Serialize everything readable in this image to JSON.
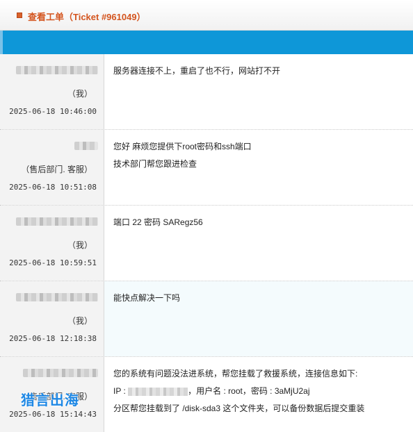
{
  "header": {
    "title": "查看工单（Ticket #961049）"
  },
  "messages": [
    {
      "role": "（我）",
      "time": "2025-06-18 10:46:00",
      "lines": [
        "服务器连接不上，重启了也不行，网站打不开"
      ]
    },
    {
      "role": "（售后部门. 客服）",
      "time": "2025-06-18 10:51:08",
      "lines": [
        "您好 麻烦您提供下root密码和ssh端口",
        "技术部门帮您跟进检查"
      ]
    },
    {
      "role": "（我）",
      "time": "2025-06-18 10:59:51",
      "lines": [
        "端口 22 密码 SARegz56"
      ]
    },
    {
      "role": "（我）",
      "time": "2025-06-18 12:18:38",
      "lines": [
        "能快点解决一下吗"
      ]
    },
    {
      "role": "（售后部门. 客服）",
      "time": "2025-06-18 15:14:43",
      "lines": [
        "您的系统有问题没法进系统，帮您挂载了救援系统，连接信息如下:"
      ],
      "ip_prefix": "IP :",
      "ip_suffix": "，用户名 : root，密码 : 3aMjU2aj",
      "last_line": "分区帮您挂载到了 /disk-sda3 这个文件夹，可以备份数据后提交重装"
    }
  ],
  "watermark": "猎言出海"
}
